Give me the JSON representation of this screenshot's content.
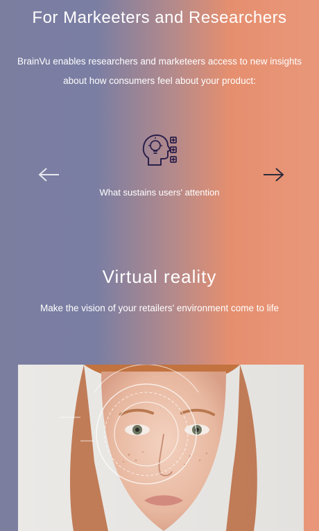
{
  "header": {
    "title": "For Markeeters and Researchers",
    "intro": "BrainVu enables researchers and marketeers access to new insights about how consumers feel about your product:"
  },
  "carousel": {
    "prev_icon": "arrow-left-icon",
    "next_icon": "arrow-right-icon",
    "current": {
      "icon": "head-lightbulb-icon",
      "label": "What sustains users' attention"
    }
  },
  "vr": {
    "title": "Virtual reality",
    "subtitle": "Make the vision of your retailers' environment come to life"
  },
  "hero": {
    "image": "woman-face-with-eye-scan-overlay"
  },
  "colors": {
    "gradient_left": "#7c7ea0",
    "gradient_right": "#e9977a",
    "icon_stroke": "#2a1f4a"
  }
}
